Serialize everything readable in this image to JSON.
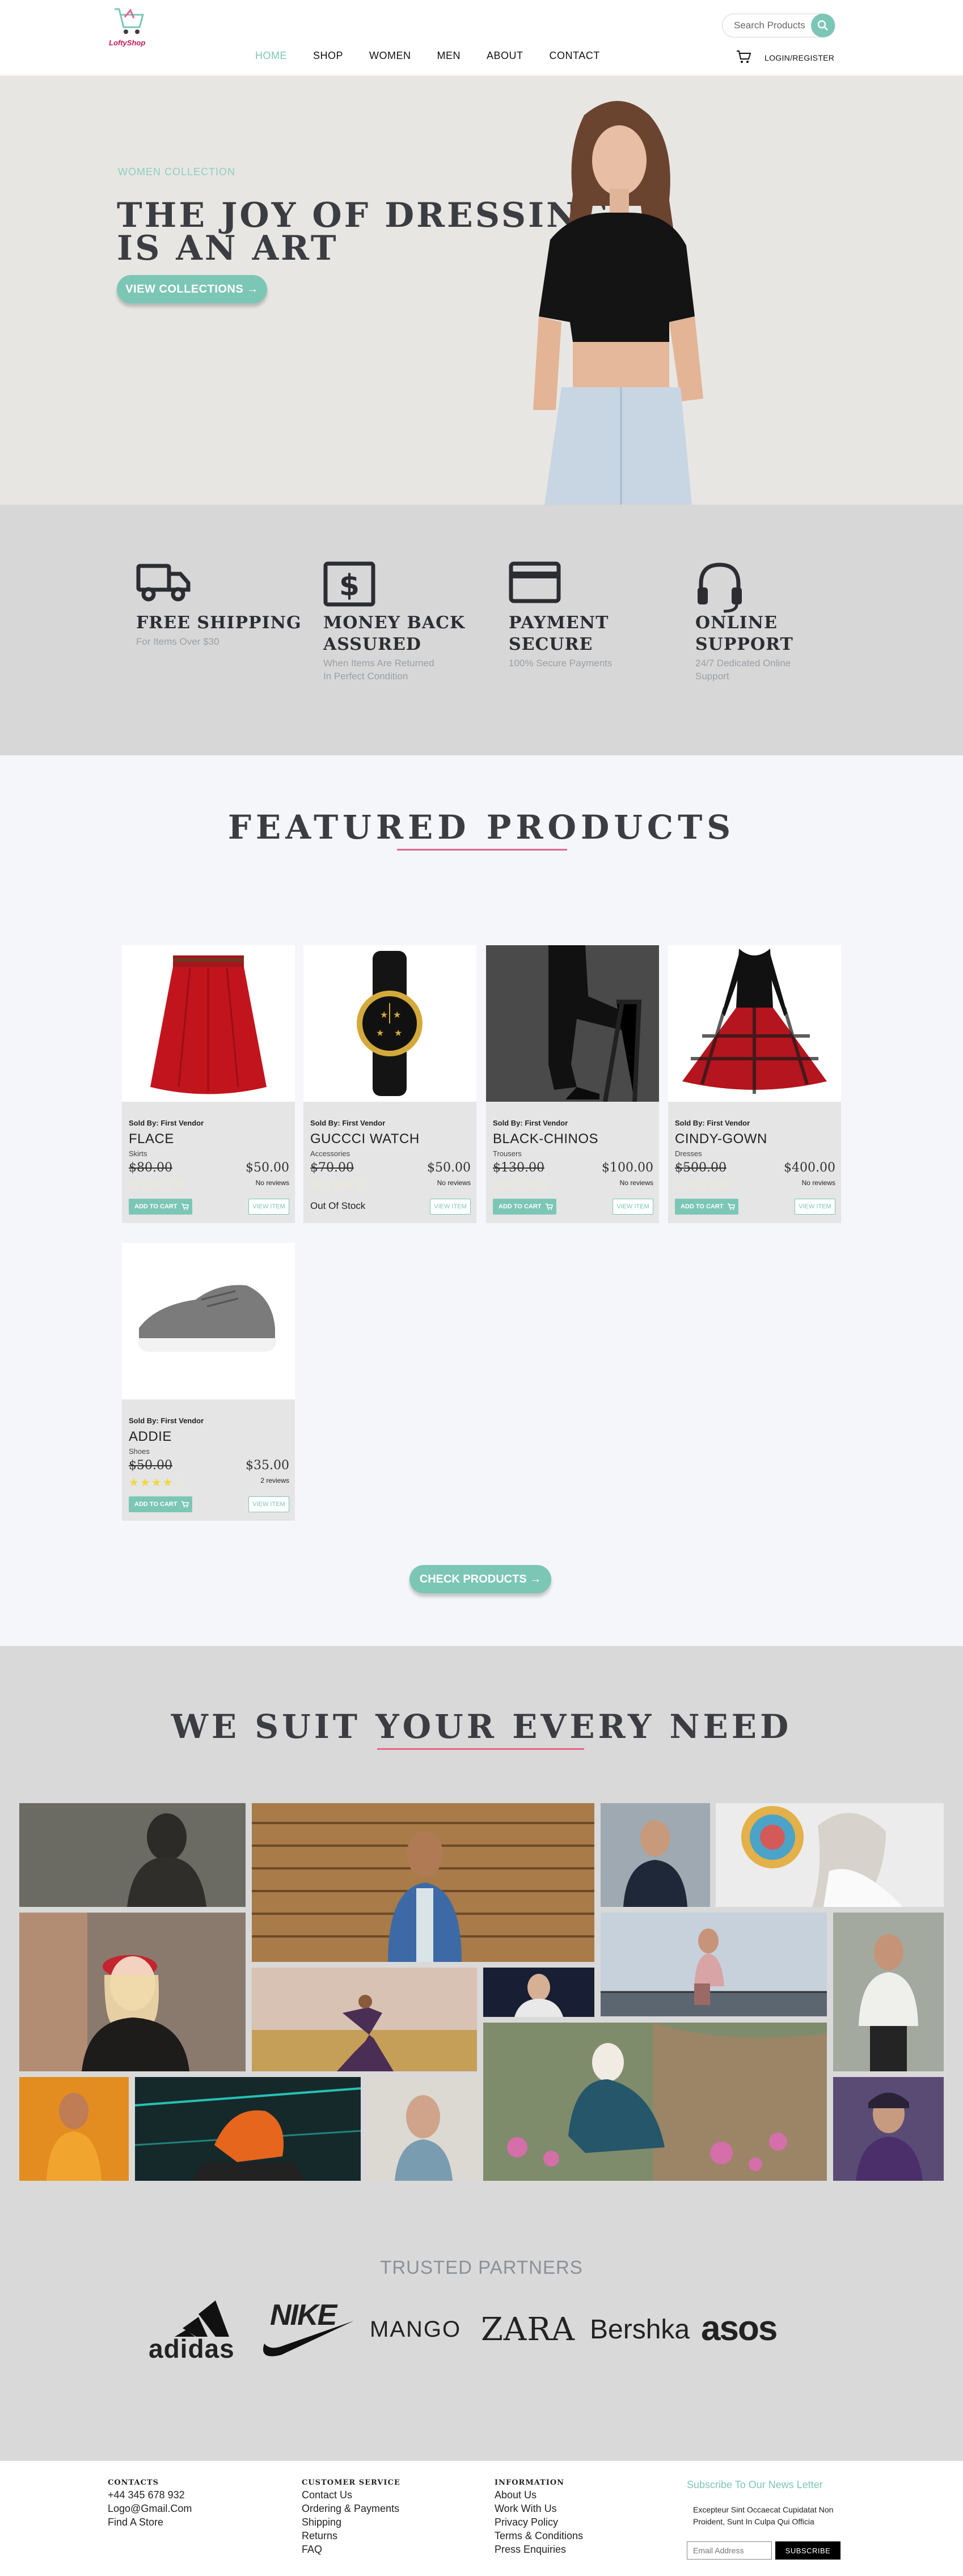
{
  "header": {
    "logo_text": "LoftyShop",
    "search_placeholder": "Search Products",
    "nav": [
      "HOME",
      "SHOP",
      "WOMEN",
      "MEN",
      "ABOUT",
      "CONTACT"
    ],
    "login": "LOGIN/REGISTER"
  },
  "hero": {
    "subtitle": "WOMEN COLLECTION",
    "title_line1": "THE JOY OF DRESSING",
    "title_line2": "IS AN ART",
    "button": "VIEW COLLECTIONS"
  },
  "features": [
    {
      "title1": "FREE SHIPPING",
      "title2": "",
      "desc1": "For Items Over $30",
      "desc2": "",
      "icon": "truck-icon"
    },
    {
      "title1": "MONEY BACK",
      "title2": "ASSURED",
      "desc1": "When Items Are Returned",
      "desc2": "In Perfect Condition",
      "icon": "dollar-icon"
    },
    {
      "title1": "PAYMENT",
      "title2": "SECURE",
      "desc1": "100% Secure Payments",
      "desc2": "",
      "icon": "credit-card-icon"
    },
    {
      "title1": "ONLINE",
      "title2": "SUPPORT",
      "desc1": "24/7 Dedicated Online",
      "desc2": "Support",
      "icon": "headset-icon"
    }
  ],
  "featured": {
    "title": "FEATURED PRODUCTS",
    "check_button": "CHECK PRODUCTS",
    "products": [
      {
        "vendor": "Sold By: First Vendor",
        "name": "FLACE",
        "category": "Skirts",
        "old_price": "$80.00",
        "price": "$50.00",
        "reviews": "No reviews",
        "rating": 0,
        "add_label": "ADD TO CART",
        "view_label": "VIEW ITEM",
        "stock": ""
      },
      {
        "vendor": "Sold By: First Vendor",
        "name": "GUCCCI WATCH",
        "category": "Accessories",
        "old_price": "$70.00",
        "price": "$50.00",
        "reviews": "No reviews",
        "rating": 0,
        "add_label": "",
        "view_label": "VIEW ITEM",
        "stock": "Out Of Stock"
      },
      {
        "vendor": "Sold By: First Vendor",
        "name": "BLACK-CHINOS",
        "category": "Trousers",
        "old_price": "$130.00",
        "price": "$100.00",
        "reviews": "No reviews",
        "rating": 0,
        "add_label": "ADD TO CART",
        "view_label": "VIEW ITEM",
        "stock": ""
      },
      {
        "vendor": "Sold By: First Vendor",
        "name": "CINDY-GOWN",
        "category": "Dresses",
        "old_price": "$500.00",
        "price": "$400.00",
        "reviews": "No reviews",
        "rating": 0,
        "add_label": "ADD TO CART",
        "view_label": "VIEW ITEM",
        "stock": ""
      },
      {
        "vendor": "Sold By: First Vendor",
        "name": "ADDIE",
        "category": "Shoes",
        "old_price": "$50.00",
        "price": "$35.00",
        "reviews": "2 reviews",
        "rating": 4,
        "add_label": "ADD TO CART",
        "view_label": "VIEW ITEM",
        "stock": ""
      }
    ]
  },
  "gallery": {
    "title": "WE SUIT YOUR EVERY NEED"
  },
  "partners": {
    "title": "TRUSTED PARTNERS",
    "brands": [
      "adidas",
      "NIKE",
      "MANGO",
      "ZARA",
      "Bershka",
      "asos"
    ]
  },
  "footer": {
    "contacts": {
      "head": "CONTACTS",
      "items": [
        "+44 345 678 932",
        "Logo@Gmail.Com",
        "Find A Store"
      ]
    },
    "service": {
      "head": "CUSTOMER SERVICE",
      "items": [
        "Contact Us",
        "Ordering & Payments",
        "Shipping",
        "Returns",
        "FAQ"
      ]
    },
    "info": {
      "head": "INFORMATION",
      "items": [
        "About Us",
        "Work With Us",
        "Privacy Policy",
        "Terms & Conditions",
        "Press Enquiries"
      ]
    },
    "newsletter": {
      "title": "Subscribe To Our News Letter",
      "text": "Excepteur Sint Occaecat Cupidatat Non Proident, Sunt In Culpa Qui Officia",
      "placeholder": "Email Address",
      "button": "SUBSCRIBE"
    }
  },
  "colors": {
    "accent": "#7cc6b6",
    "pink": "#e4668a",
    "heading": "#3b3d42"
  }
}
